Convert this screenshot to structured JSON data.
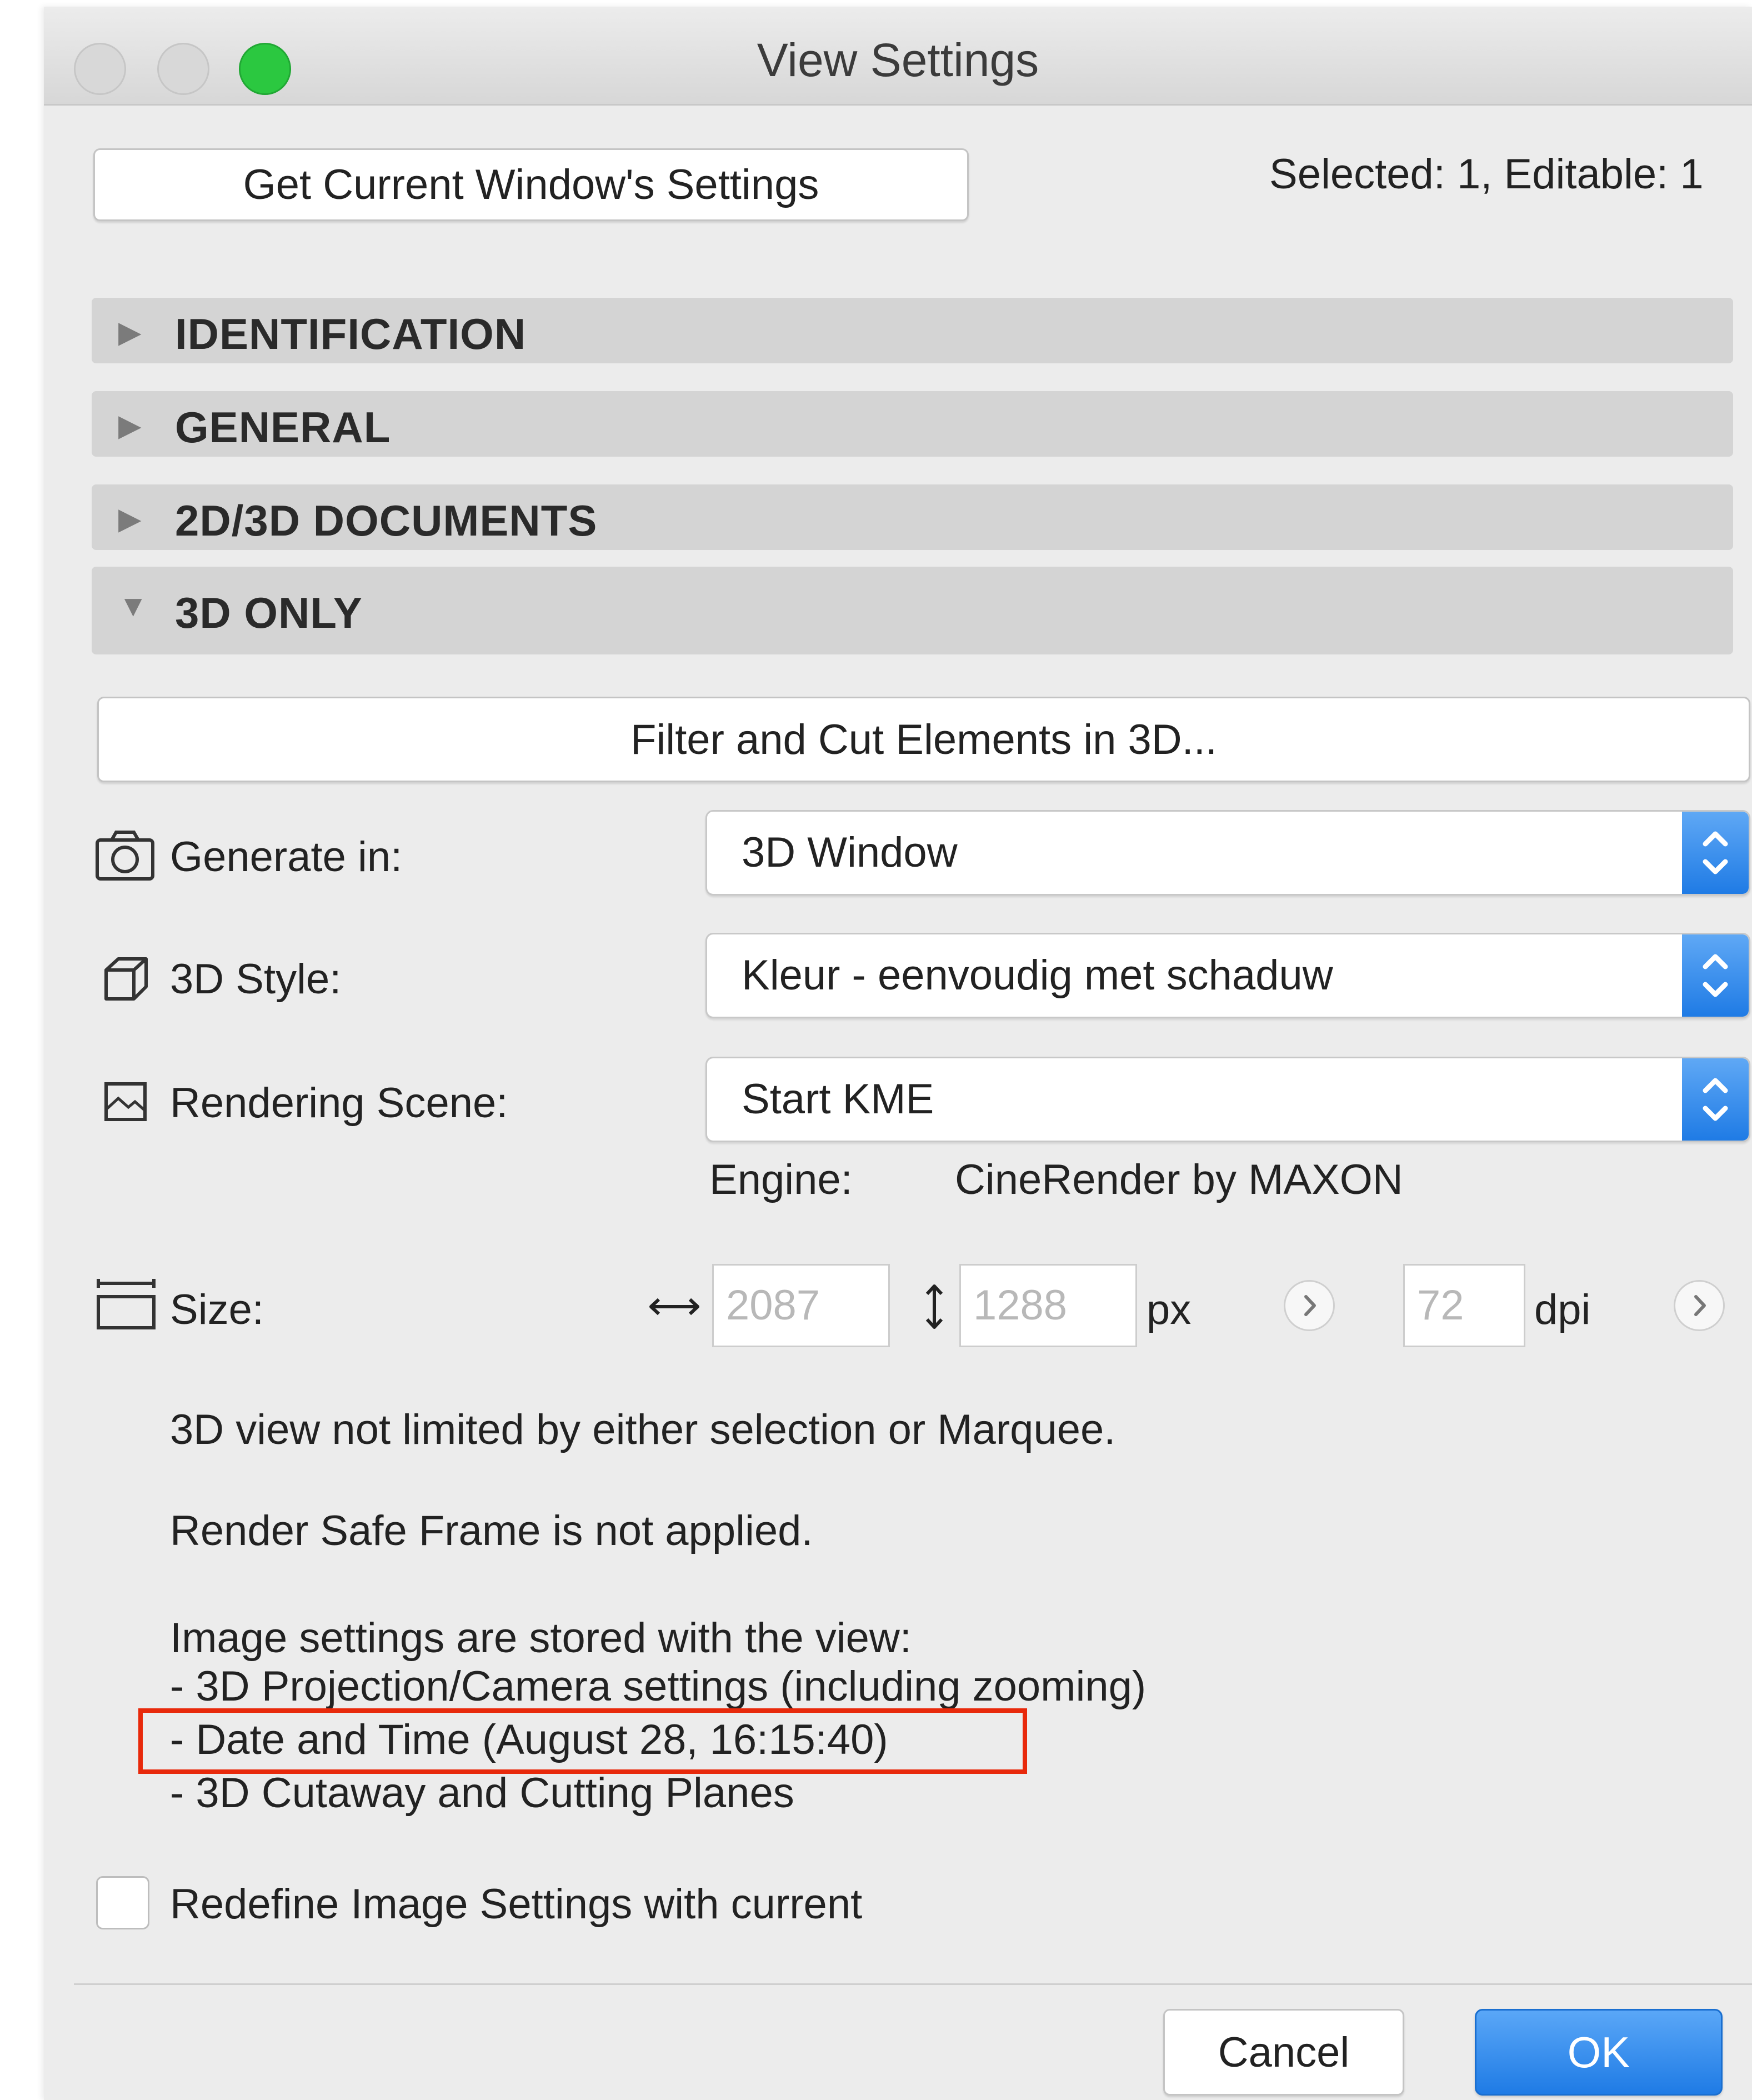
{
  "window": {
    "title": "View Settings"
  },
  "toolbar": {
    "get_settings_label": "Get Current Window's Settings",
    "selection_status": "Selected: 1, Editable: 1"
  },
  "sections": [
    {
      "label": "IDENTIFICATION",
      "expanded": false
    },
    {
      "label": "GENERAL",
      "expanded": false
    },
    {
      "label": "2D/3D DOCUMENTS",
      "expanded": false
    },
    {
      "label": "3D ONLY",
      "expanded": true
    }
  ],
  "three_d": {
    "filter_button_label": "Filter and Cut Elements in 3D...",
    "generate_in": {
      "label": "Generate in:",
      "value": "3D Window",
      "icon": "camera-icon"
    },
    "style": {
      "label": "3D Style:",
      "value": "Kleur - eenvoudig met schaduw",
      "icon": "cube-icon"
    },
    "rendering_scene": {
      "label": "Rendering Scene:",
      "value": "Start KME",
      "icon": "picture-icon"
    },
    "engine": {
      "label": "Engine:",
      "value": "CineRender by MAXON"
    },
    "size": {
      "label": "Size:",
      "icon": "size-icon",
      "width": "2087",
      "height": "1288",
      "px_unit": "px",
      "dpi": "72",
      "dpi_unit": "dpi"
    },
    "notes": {
      "marquee": "3D view not limited by either selection or Marquee.",
      "safe_frame": "Render Safe Frame is not applied.",
      "stored_intro": "Image settings are stored with the view:",
      "stored_items": [
        "- 3D Projection/Camera settings (including zooming)",
        "- Date and Time (August 28, 16:15:40)",
        "- 3D Cutaway and Cutting Planes"
      ]
    },
    "redefine_label": "Redefine Image Settings with current"
  },
  "footer": {
    "cancel_label": "Cancel",
    "ok_label": "OK"
  },
  "colors": {
    "accent": "#1f7be5",
    "highlight_box": "#e8290b",
    "zoom_button": "#2bc840"
  }
}
